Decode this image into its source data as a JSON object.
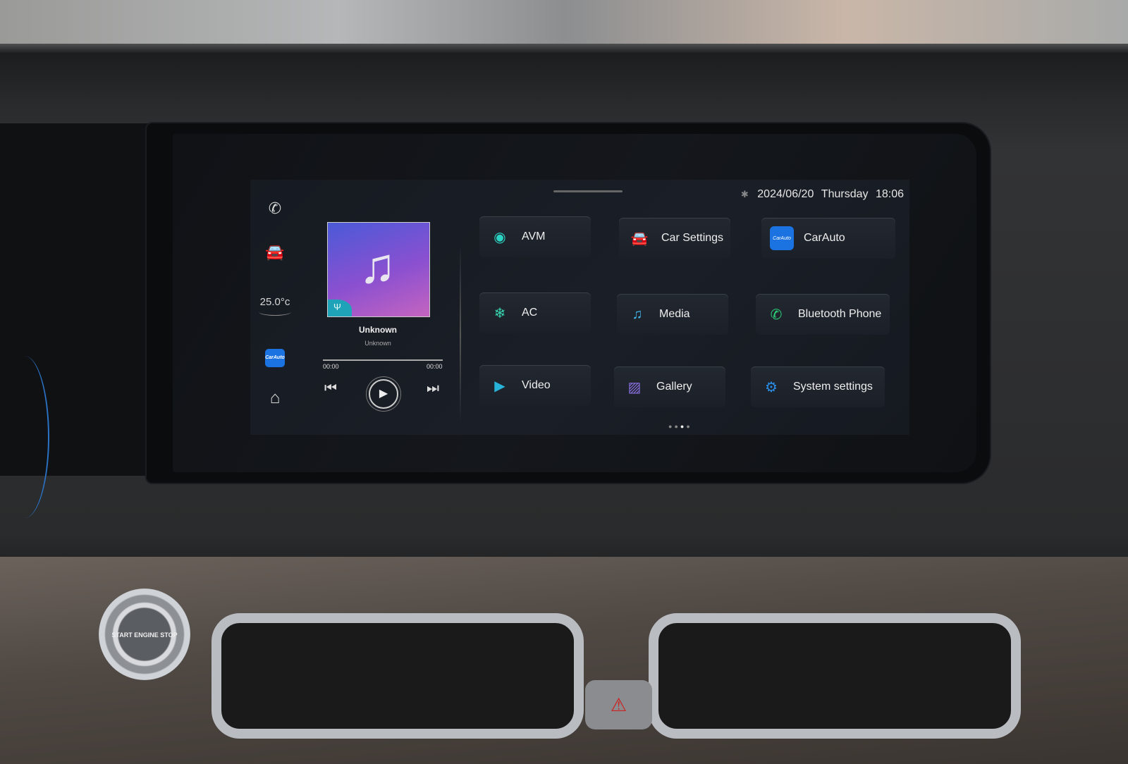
{
  "status_bar": {
    "bluetooth_icon": "bluetooth-icon",
    "date": "2024/06/20",
    "weekday": "Thursday",
    "time": "18:06"
  },
  "dock": {
    "items": [
      {
        "name": "phone",
        "icon": "phone-icon"
      },
      {
        "name": "vehicle",
        "icon": "car-icon"
      },
      {
        "name": "temperature",
        "label": "25.0°c"
      },
      {
        "name": "carauto",
        "label": "CarAuto"
      },
      {
        "name": "home",
        "icon": "home-icon"
      }
    ]
  },
  "music": {
    "title": "Unknown",
    "artist": "Unknown",
    "elapsed": "00:00",
    "duration": "00:00",
    "progress": 0,
    "source_icon": "usb-icon"
  },
  "apps": [
    {
      "label": "AVM",
      "icon": "avm-icon",
      "color": "#2bd3c4"
    },
    {
      "label": "Car Settings",
      "icon": "car-icon",
      "color": "#c9ccd2"
    },
    {
      "label": "CarAuto",
      "icon": "carauto-icon",
      "color": "#1a73e0"
    },
    {
      "label": "AC",
      "icon": "snowflake-icon",
      "color": "#38d6b0"
    },
    {
      "label": "Media",
      "icon": "music-icon",
      "color": "#3fb6e8"
    },
    {
      "label": "Bluetooth Phone",
      "icon": "phone-icon",
      "color": "#2bd37a"
    },
    {
      "label": "Video",
      "icon": "video-icon",
      "color": "#28b4d8"
    },
    {
      "label": "Gallery",
      "icon": "gallery-icon",
      "color": "#8a6ee0"
    },
    {
      "label": "System settings",
      "icon": "gear-icon",
      "color": "#2a8ee8"
    }
  ],
  "pager": {
    "pages": 4,
    "current": 3
  },
  "hardware": {
    "start_button": "START ENGINE STOP"
  }
}
